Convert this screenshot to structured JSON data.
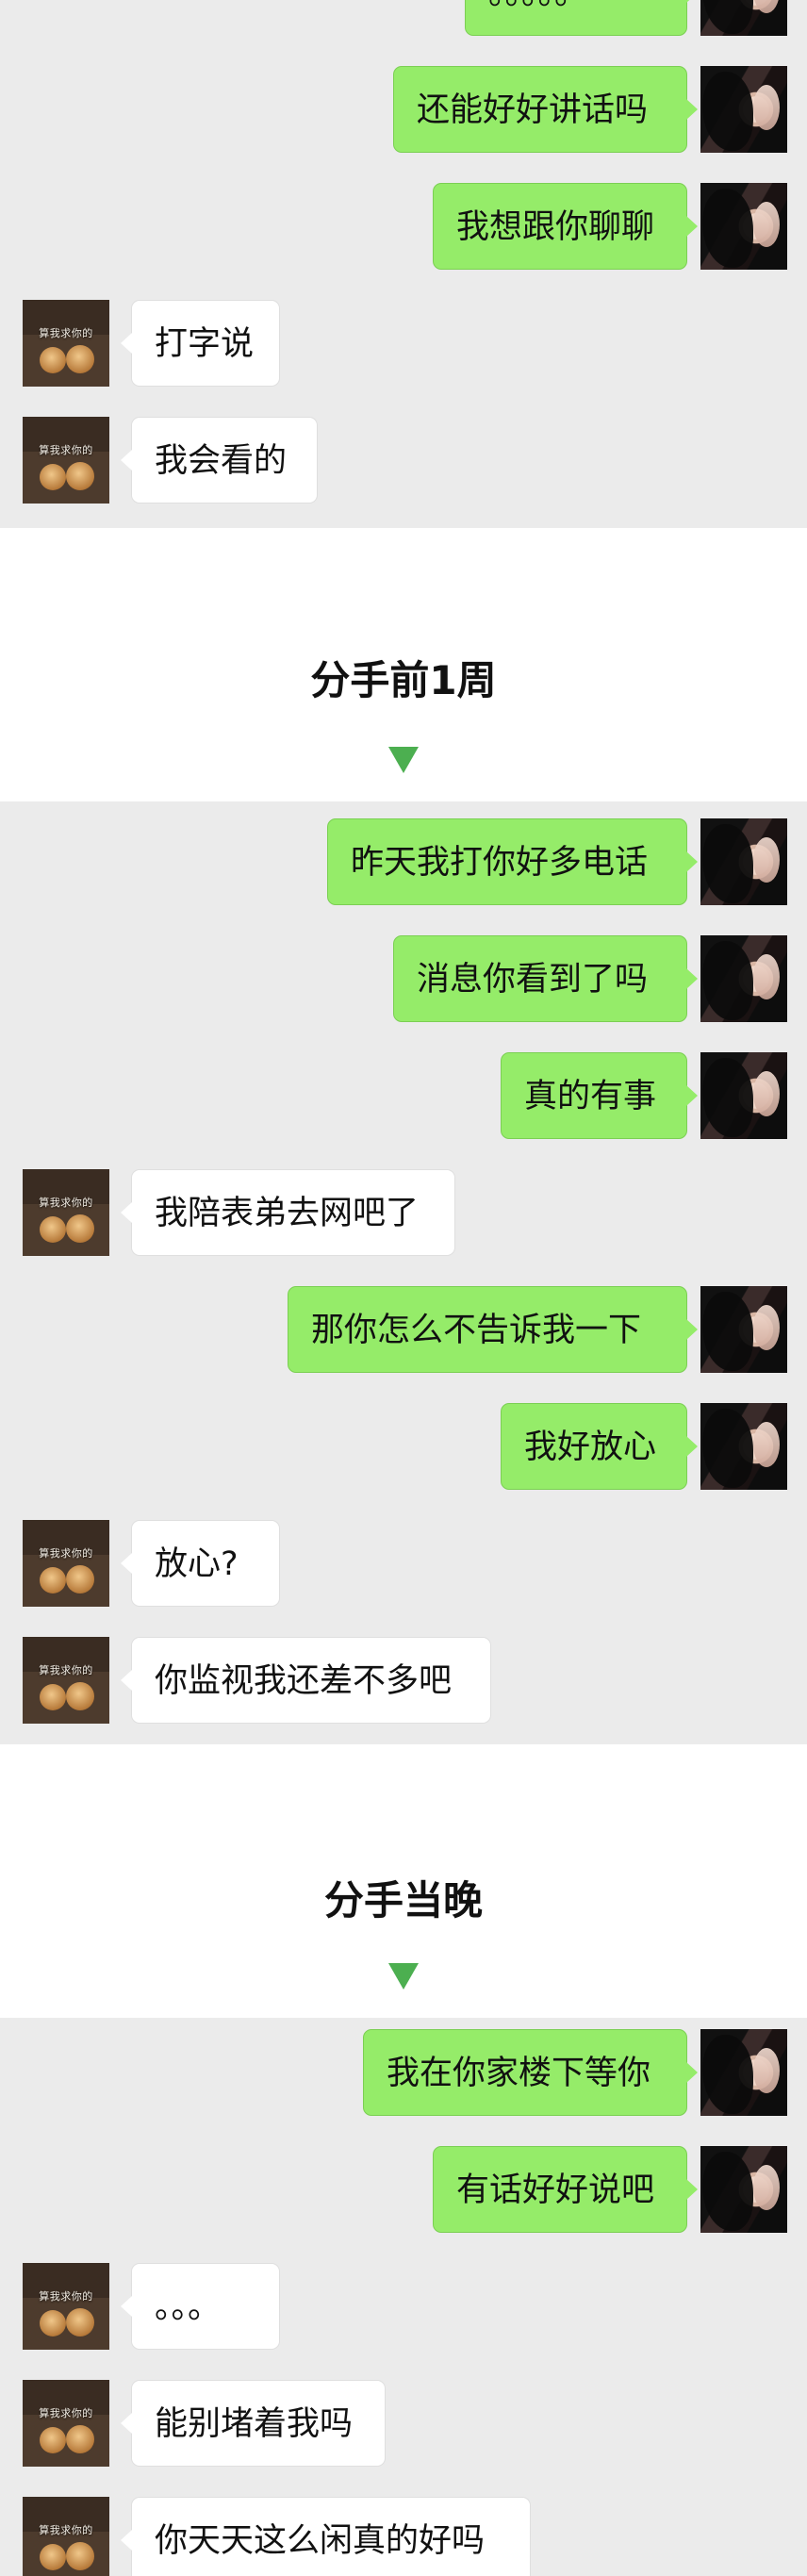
{
  "sections": [
    {
      "title": "",
      "messages": [
        {
          "side": "right",
          "text": "。。。。。"
        },
        {
          "side": "right",
          "text": "还能好好讲话吗"
        },
        {
          "side": "right",
          "text": "我想跟你聊聊"
        },
        {
          "side": "left",
          "text": "打字说"
        },
        {
          "side": "left",
          "text": "我会看的"
        }
      ]
    },
    {
      "title": "分手前1周",
      "messages": [
        {
          "side": "right",
          "text": "昨天我打你好多电话"
        },
        {
          "side": "right",
          "text": "消息你看到了吗"
        },
        {
          "side": "right",
          "text": "真的有事"
        },
        {
          "side": "left",
          "text": "我陪表弟去网吧了"
        },
        {
          "side": "right",
          "text": "那你怎么不告诉我一下"
        },
        {
          "side": "right",
          "text": "我好放心"
        },
        {
          "side": "left",
          "text": "放心?"
        },
        {
          "side": "left",
          "text": "你监视我还差不多吧"
        }
      ]
    },
    {
      "title": "分手当晚",
      "messages": [
        {
          "side": "right",
          "text": "我在你家楼下等你"
        },
        {
          "side": "right",
          "text": "有话好好说吧"
        },
        {
          "side": "left",
          "text": "。。。"
        },
        {
          "side": "left",
          "text": "能别堵着我吗"
        },
        {
          "side": "left",
          "text": "你天天这么闲真的好吗"
        }
      ]
    }
  ],
  "avatar_caption": "算我求你的"
}
